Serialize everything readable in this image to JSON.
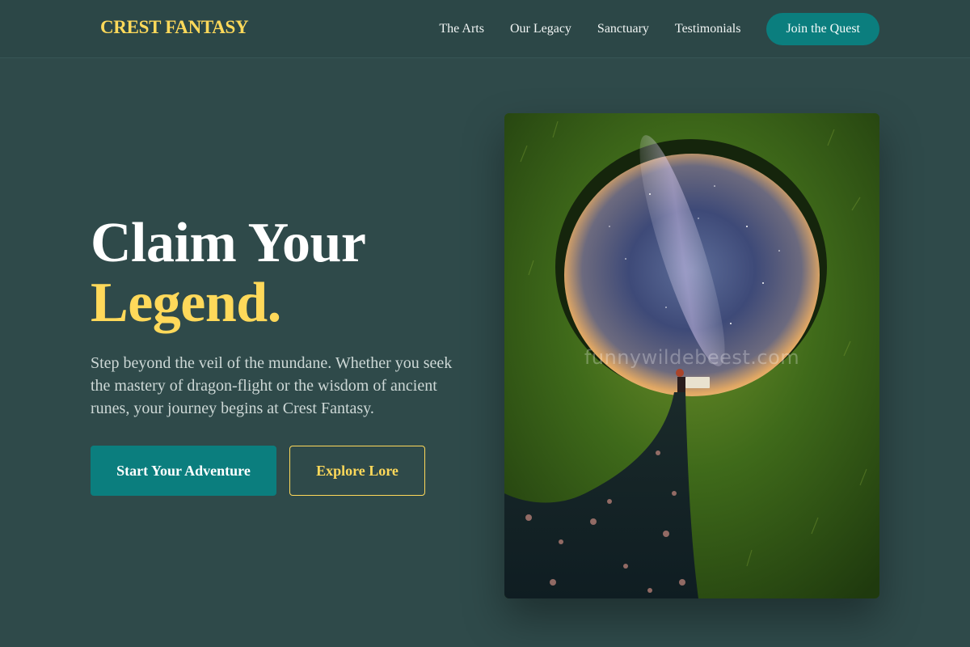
{
  "header": {
    "logo": "CREST FANTASY",
    "nav": [
      "The Arts",
      "Our Legacy",
      "Sanctuary",
      "Testimonials"
    ],
    "cta": "Join the Quest"
  },
  "hero": {
    "title_line1": "Claim Your",
    "title_line2": "Legend.",
    "description": "Step beyond the veil of the mundane. Whether you seek the mastery of dragon-flight or the wisdom of ancient runes, your journey begins at Crest Fantasy.",
    "primary_button": "Start Your Adventure",
    "secondary_button": "Explore Lore",
    "image_watermark": "funnywildebeest.com"
  },
  "colors": {
    "background": "#2f4a4a",
    "accent_gold": "#ffd95a",
    "teal": "#0b7e7e"
  }
}
